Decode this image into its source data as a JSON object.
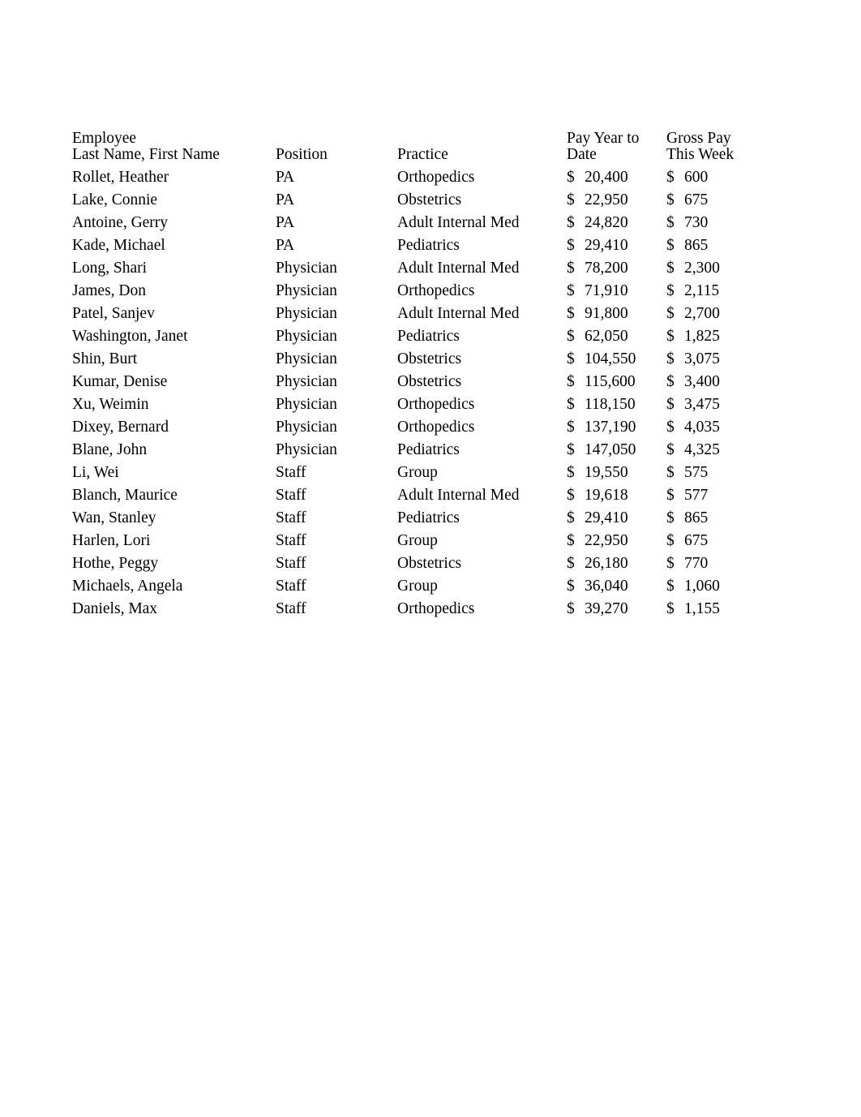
{
  "table": {
    "headers": {
      "employee_line1": "Employee",
      "employee_line2": "Last Name, First Name",
      "position": "Position",
      "practice": "Practice",
      "pay_ytd_line1": "Pay Year to",
      "pay_ytd_line2": "Date",
      "gross_pay_line1": "Gross Pay",
      "gross_pay_line2": "This Week"
    },
    "currency_symbol": "$",
    "rows": [
      {
        "name": "Rollet, Heather",
        "position": "PA",
        "practice": "Orthopedics",
        "pay_ytd": "20,400",
        "gross_week": "600"
      },
      {
        "name": "Lake, Connie",
        "position": "PA",
        "practice": "Obstetrics",
        "pay_ytd": "22,950",
        "gross_week": "675"
      },
      {
        "name": "Antoine, Gerry",
        "position": "PA",
        "practice": "Adult Internal Med",
        "pay_ytd": "24,820",
        "gross_week": "730"
      },
      {
        "name": "Kade, Michael",
        "position": "PA",
        "practice": "Pediatrics",
        "pay_ytd": "29,410",
        "gross_week": "865"
      },
      {
        "name": "Long, Shari",
        "position": "Physician",
        "practice": "Adult Internal Med",
        "pay_ytd": "78,200",
        "gross_week": "2,300"
      },
      {
        "name": "James, Don",
        "position": "Physician",
        "practice": "Orthopedics",
        "pay_ytd": "71,910",
        "gross_week": "2,115"
      },
      {
        "name": "Patel, Sanjev",
        "position": "Physician",
        "practice": "Adult Internal Med",
        "pay_ytd": "91,800",
        "gross_week": "2,700"
      },
      {
        "name": "Washington, Janet",
        "position": "Physician",
        "practice": "Pediatrics",
        "pay_ytd": "62,050",
        "gross_week": "1,825"
      },
      {
        "name": "Shin, Burt",
        "position": "Physician",
        "practice": "Obstetrics",
        "pay_ytd": "104,550",
        "gross_week": "3,075"
      },
      {
        "name": "Kumar, Denise",
        "position": "Physician",
        "practice": "Obstetrics",
        "pay_ytd": "115,600",
        "gross_week": "3,400"
      },
      {
        "name": "Xu, Weimin",
        "position": "Physician",
        "practice": "Orthopedics",
        "pay_ytd": "118,150",
        "gross_week": "3,475"
      },
      {
        "name": "Dixey, Bernard",
        "position": "Physician",
        "practice": "Orthopedics",
        "pay_ytd": "137,190",
        "gross_week": "4,035"
      },
      {
        "name": "Blane, John",
        "position": "Physician",
        "practice": "Pediatrics",
        "pay_ytd": "147,050",
        "gross_week": "4,325"
      },
      {
        "name": "Li, Wei",
        "position": "Staff",
        "practice": "Group",
        "pay_ytd": "19,550",
        "gross_week": "575"
      },
      {
        "name": "Blanch, Maurice",
        "position": "Staff",
        "practice": "Adult Internal Med",
        "pay_ytd": "19,618",
        "gross_week": "577"
      },
      {
        "name": "Wan, Stanley",
        "position": "Staff",
        "practice": "Pediatrics",
        "pay_ytd": "29,410",
        "gross_week": "865"
      },
      {
        "name": "Harlen, Lori",
        "position": "Staff",
        "practice": "Group",
        "pay_ytd": "22,950",
        "gross_week": "675"
      },
      {
        "name": "Hothe, Peggy",
        "position": "Staff",
        "practice": "Obstetrics",
        "pay_ytd": "26,180",
        "gross_week": "770"
      },
      {
        "name": "Michaels, Angela",
        "position": "Staff",
        "practice": "Group",
        "pay_ytd": "36,040",
        "gross_week": "1,060"
      },
      {
        "name": "Daniels, Max",
        "position": "Staff",
        "practice": "Orthopedics",
        "pay_ytd": "39,270",
        "gross_week": "1,155"
      }
    ]
  }
}
